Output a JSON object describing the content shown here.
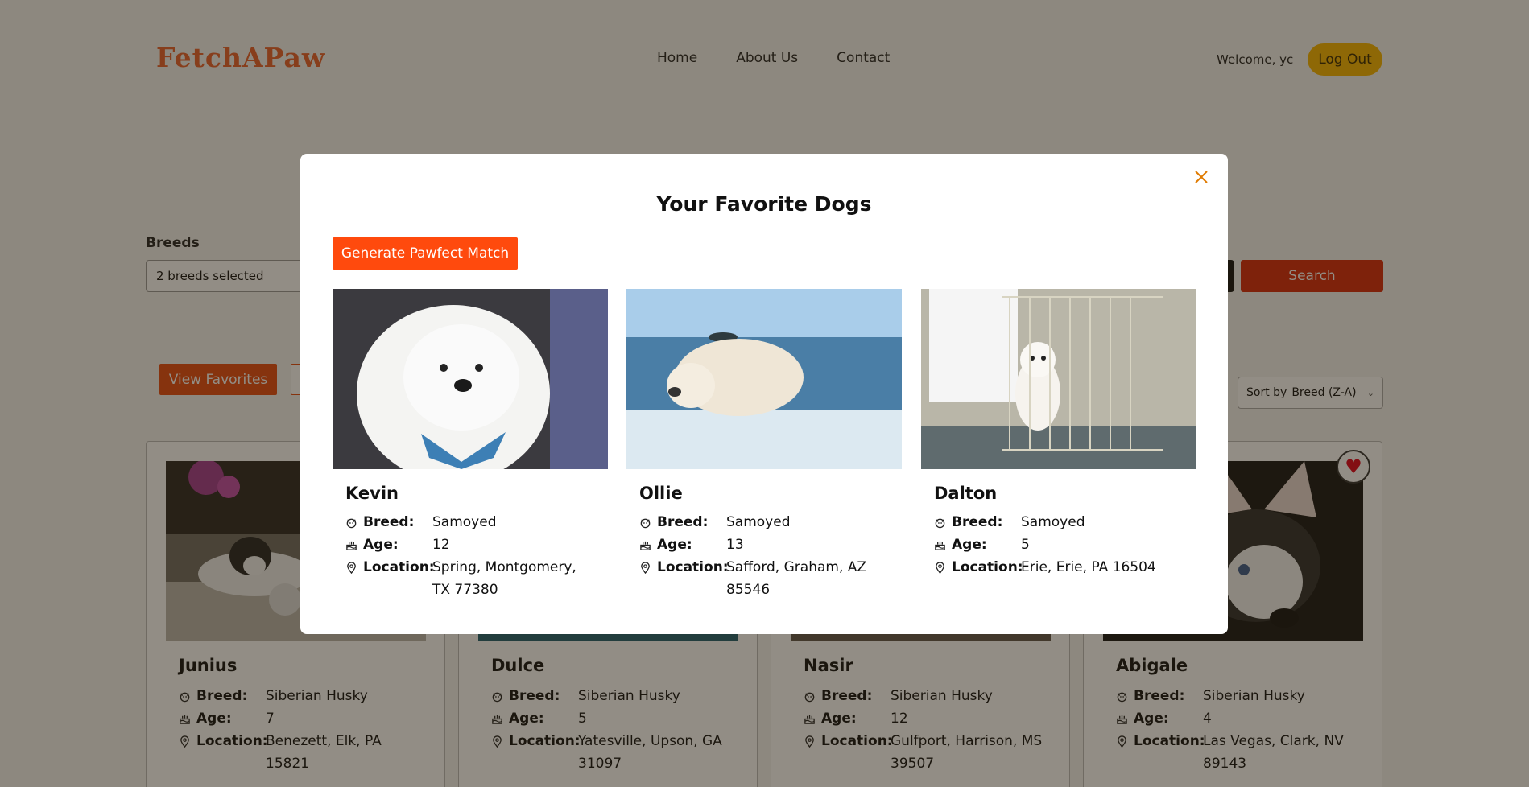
{
  "header": {
    "logo": "FetchAPaw",
    "nav": [
      "Home",
      "About Us",
      "Contact"
    ],
    "welcome": "Welcome, yc",
    "logout": "Log Out"
  },
  "filters": {
    "breeds_label": "Breeds",
    "breeds_value": "2 breeds selected",
    "search_label": "Search",
    "view_favorites": "View Favorites",
    "sort_prefix": "Sort by",
    "sort_value": "Breed (Z-A)"
  },
  "labels": {
    "breed": "Breed:",
    "age": "Age:",
    "location": "Location:"
  },
  "grid_dogs": [
    {
      "name": "Junius",
      "breed": "Siberian Husky",
      "age": "7",
      "location": "Benezett, Elk, PA 15821"
    },
    {
      "name": "Dulce",
      "breed": "Siberian Husky",
      "age": "5",
      "location": "Yatesville, Upson, GA 31097"
    },
    {
      "name": "Nasir",
      "breed": "Siberian Husky",
      "age": "12",
      "location": "Gulfport, Harrison, MS 39507"
    },
    {
      "name": "Abigale",
      "breed": "Siberian Husky",
      "age": "4",
      "location": "Las Vegas, Clark, NV 89143",
      "favorited": true
    }
  ],
  "modal": {
    "title": "Your Favorite Dogs",
    "generate_button": "Generate Pawfect Match",
    "dogs": [
      {
        "name": "Kevin",
        "breed": "Samoyed",
        "age": "12",
        "location": "Spring, Montgomery, TX 77380"
      },
      {
        "name": "Ollie",
        "breed": "Samoyed",
        "age": "13",
        "location": "Safford, Graham, AZ 85546"
      },
      {
        "name": "Dalton",
        "breed": "Samoyed",
        "age": "5",
        "location": "Erie, Erie, PA 16504"
      }
    ]
  },
  "colors": {
    "brand": "#e8612c",
    "primary_button": "#ff4a0d",
    "logout": "#f6b500",
    "close_icon": "#e07a00",
    "heart": "#e0001b"
  }
}
